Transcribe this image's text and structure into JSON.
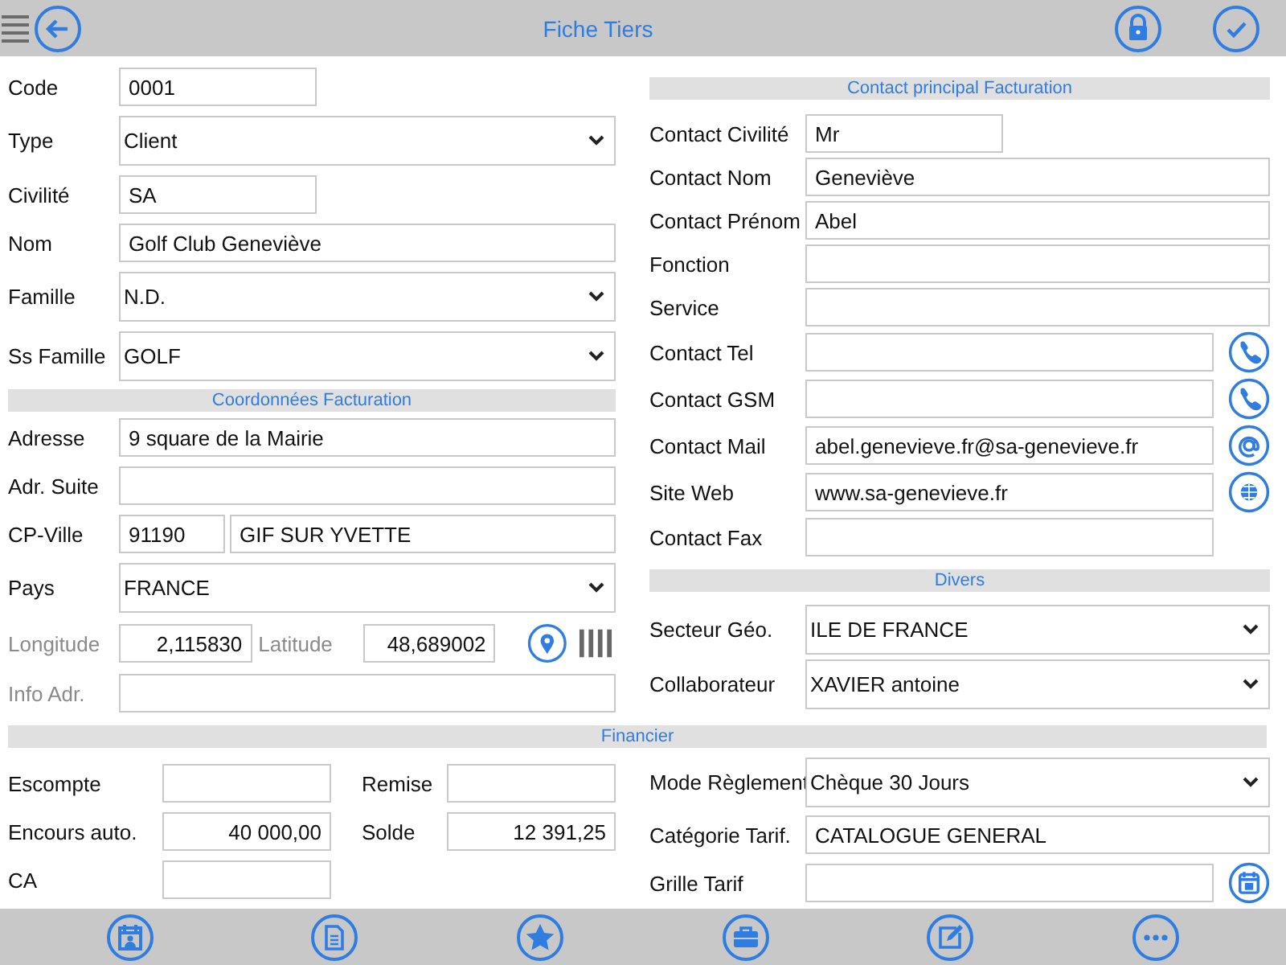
{
  "window": {
    "title": "Fiche Tiers"
  },
  "identity_fields": [
    {
      "kind": "short",
      "label": "Code",
      "value": "0001",
      "disabled": false
    },
    {
      "kind": "select",
      "label": "Type",
      "value": "Client",
      "disabled": false
    },
    {
      "kind": "short",
      "label": "Civilité",
      "value": "SA",
      "disabled": false
    },
    {
      "kind": "text",
      "label": "Nom",
      "value": "Golf Club Geneviève",
      "disabled": false
    },
    {
      "kind": "select",
      "label": "Famille",
      "value": "N.D.",
      "disabled": false
    },
    {
      "kind": "select",
      "label": "Ss Famille",
      "value": "GOLF",
      "disabled": false
    }
  ],
  "billing_header": "Coordonnées Facturation",
  "billing_fields": [
    {
      "kind": "text",
      "label": "Adresse",
      "value": "9 square de la Mairie",
      "disabled": false
    },
    {
      "kind": "text",
      "label": "Adr. Suite",
      "disabled": false
    },
    {
      "kind": "split",
      "label": "CP-Ville",
      "value": "91190",
      "value_2": "GIF SUR YVETTE",
      "disabled": false
    },
    {
      "kind": "select",
      "label": "Pays",
      "value": "FRANCE",
      "disabled": false
    },
    {
      "kind": "geo",
      "label": "Longitude",
      "value": "2,115830",
      "label_2": "Latitude",
      "value_2": "48,689002",
      "disabled": true
    },
    {
      "kind": "text",
      "label": "Info Adr.",
      "disabled": true
    }
  ],
  "contact_header": "Contact principal Facturation",
  "contact_fields": [
    {
      "kind": "short",
      "label": "Contact Civilité",
      "value": "Mr"
    },
    {
      "kind": "text",
      "label": "Contact Nom",
      "value": "Geneviève"
    },
    {
      "kind": "text",
      "label": "Contact Prénom",
      "value": "Abel"
    },
    {
      "kind": "text",
      "label": "Fonction"
    },
    {
      "kind": "text",
      "label": "Service"
    },
    {
      "kind": "phone",
      "label": "Contact Tel"
    },
    {
      "kind": "phone",
      "label": "Contact GSM"
    },
    {
      "kind": "mail",
      "label": "Contact Mail",
      "value": "abel.genevieve.fr@sa-genevieve.fr"
    },
    {
      "kind": "web",
      "label": "Site Web",
      "value": "www.sa-genevieve.fr"
    },
    {
      "kind": "narrow",
      "label": "Contact Fax"
    }
  ],
  "misc_header": "Divers",
  "misc_fields": [
    {
      "kind": "select",
      "label": "Secteur Géo.",
      "value": "ILE DE FRANCE"
    },
    {
      "kind": "select",
      "label": "Collaborateur",
      "value": "XAVIER antoine"
    }
  ],
  "finance_header": "Financier",
  "finance_amounts": [
    {
      "label": "Escompte"
    },
    {
      "label": "Remise"
    },
    {
      "label": "Encours auto.",
      "value": "40 000,00"
    },
    {
      "label": "Solde",
      "value": "12 391,25"
    },
    {
      "label": "CA"
    }
  ],
  "payment_fields": [
    {
      "kind": "select",
      "label": "Mode Règlement",
      "value": "Chèque 30 Jours"
    },
    {
      "kind": "text",
      "label": "Catégorie Tarif.",
      "value": "CATALOGUE GENERAL"
    },
    {
      "kind": "tariff",
      "label": "Grille Tarif"
    }
  ]
}
